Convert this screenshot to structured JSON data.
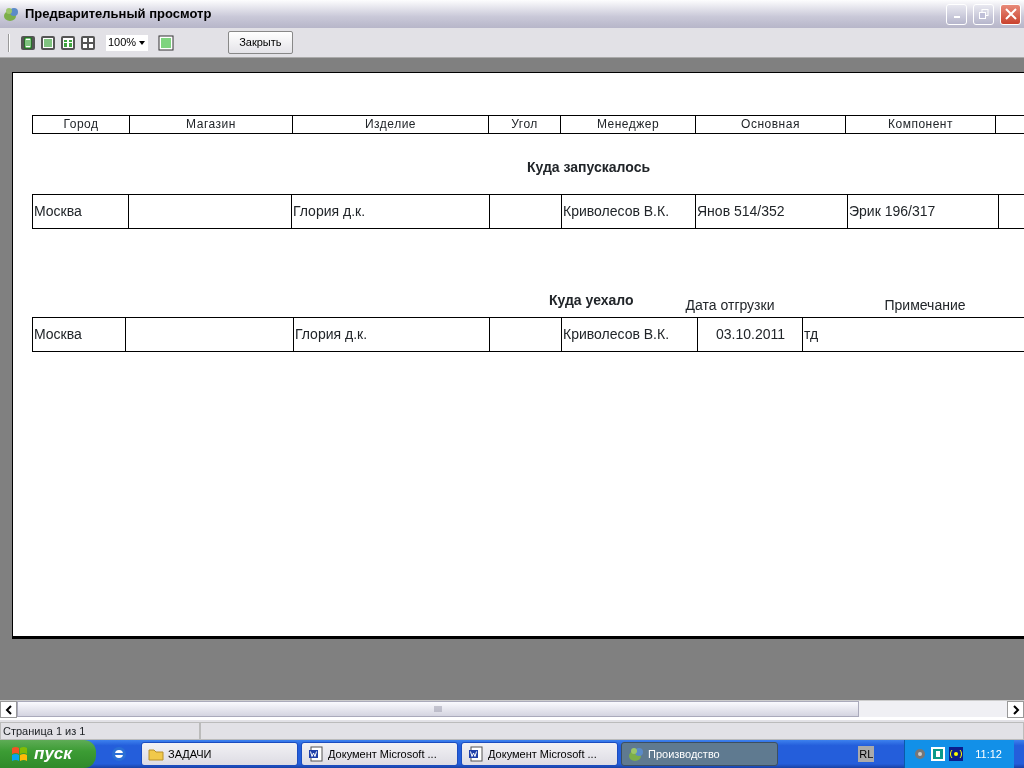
{
  "window": {
    "title": "Предварительный просмотр"
  },
  "toolbar": {
    "zoom": "100%",
    "close_button": "Закрыть"
  },
  "report": {
    "columns": [
      "Город",
      "Магазин",
      "Изделие",
      "Угол",
      "Менеджер",
      "Основная",
      "Компонент"
    ],
    "sections": [
      {
        "title": "Куда запускалось",
        "row": {
          "city": "Москва",
          "product": "Глория д.к.",
          "manager": "Криволесов В.К.",
          "main": "Янов 514/352",
          "component": "Эрик 196/317"
        }
      },
      {
        "title": "Куда уехало",
        "labels": [
          "Дата отгрузки",
          "Примечание"
        ],
        "row": {
          "city": "Москва",
          "product": "Глория д.к.",
          "manager": "Криволесов В.К.",
          "ship_date": "03.10.2011",
          "note": "тд"
        }
      }
    ]
  },
  "status_bar": {
    "text": "Страница 1 из 1"
  },
  "taskbar": {
    "start": "пуск",
    "tasks": [
      {
        "label": "ЗАДАЧИ",
        "kind": "folder",
        "selected": false
      },
      {
        "label": "Документ Microsoft ...",
        "kind": "word",
        "selected": false
      },
      {
        "label": "Документ Microsoft ...",
        "kind": "word",
        "selected": false
      },
      {
        "label": "Производство",
        "kind": "app",
        "selected": true
      }
    ],
    "language": "RL",
    "clock": "11:12"
  }
}
